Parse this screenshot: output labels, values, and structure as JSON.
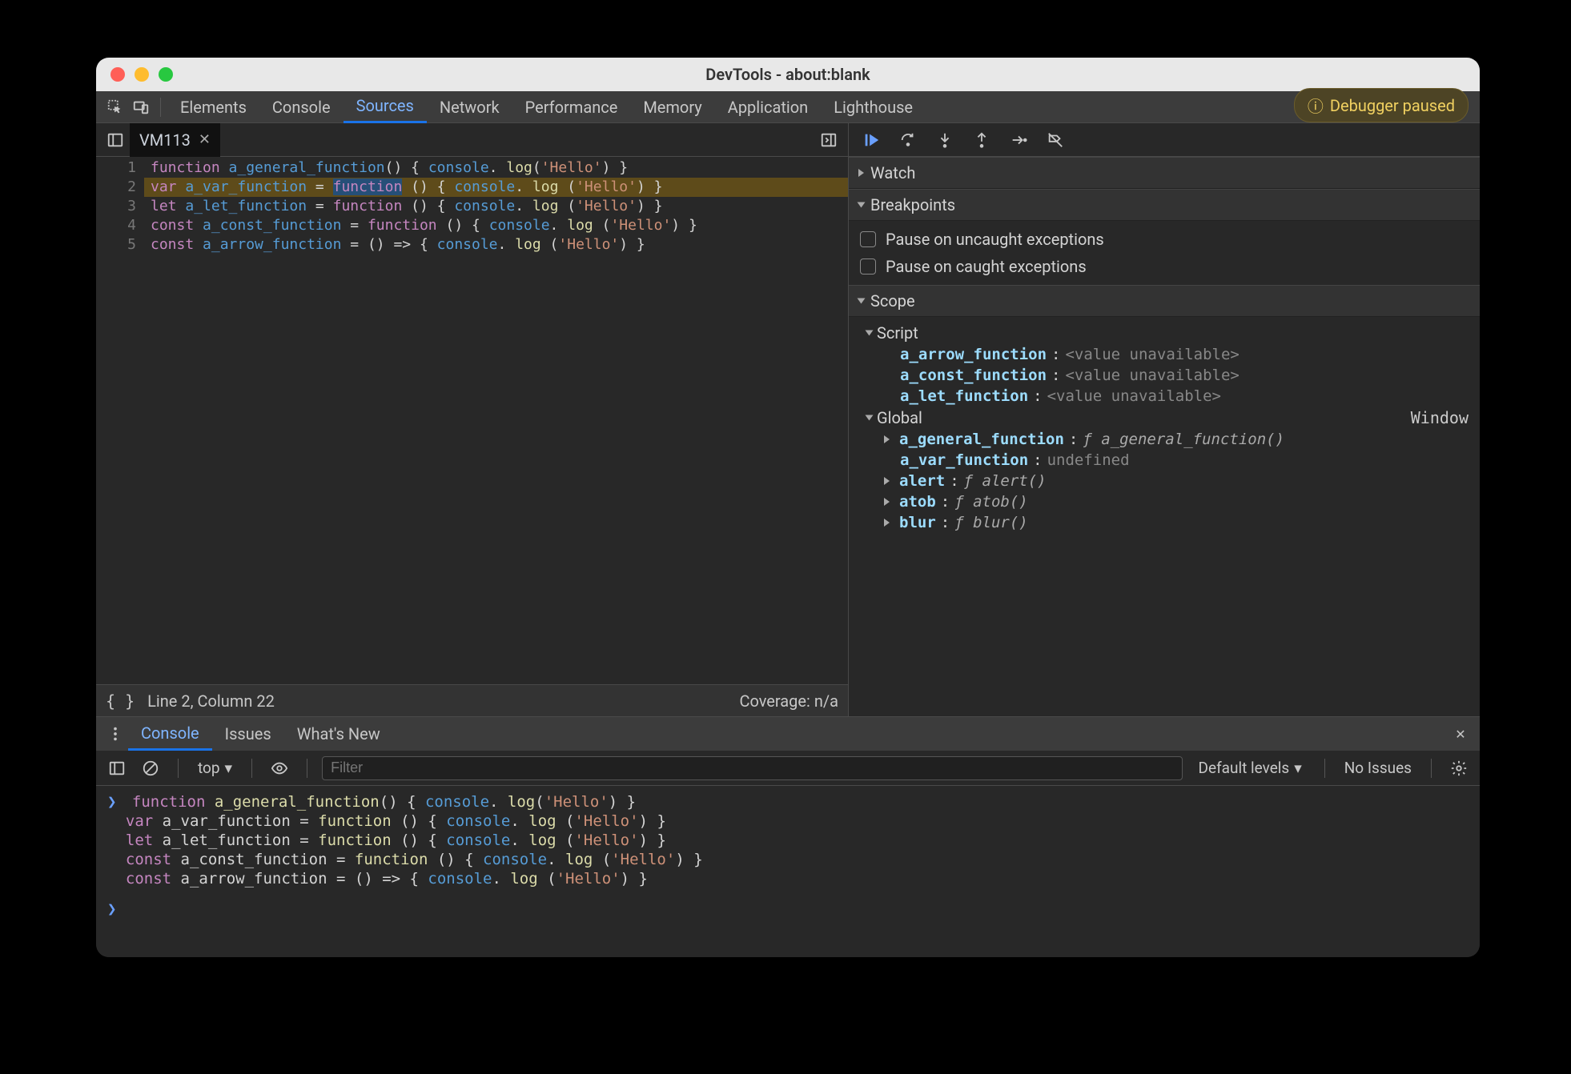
{
  "window": {
    "title": "DevTools - about:blank"
  },
  "main_tabs": [
    "Elements",
    "Console",
    "Sources",
    "Network",
    "Performance",
    "Memory",
    "Application",
    "Lighthouse"
  ],
  "main_active": "Sources",
  "file_tab": {
    "name": "VM113",
    "closeable": true
  },
  "editor": {
    "lines": [
      {
        "n": 1,
        "tokens": [
          [
            "function ",
            "k-purple"
          ],
          [
            "a_general_function",
            "k-blue"
          ],
          [
            "() { ",
            "k-plain"
          ],
          [
            "console",
            "k-blue"
          ],
          [
            ". ",
            "k-plain"
          ],
          [
            "log",
            "k-fn"
          ],
          [
            "(",
            "k-plain"
          ],
          [
            "'Hello'",
            "k-str"
          ],
          [
            ") }",
            "k-plain"
          ]
        ]
      },
      {
        "n": 2,
        "hl": true,
        "tokens": [
          [
            "var ",
            "k-purple"
          ],
          [
            "a_var_function ",
            "k-blue"
          ],
          [
            "= ",
            "k-plain"
          ],
          [
            "function",
            "k-purple",
            "sel"
          ],
          [
            " () { ",
            "k-plain"
          ],
          [
            "console",
            "k-blue"
          ],
          [
            ". ",
            "k-plain"
          ],
          [
            "log",
            "k-fn"
          ],
          [
            " (",
            "k-plain"
          ],
          [
            "'Hello'",
            "k-str"
          ],
          [
            ") }",
            "k-plain"
          ]
        ]
      },
      {
        "n": 3,
        "tokens": [
          [
            "let ",
            "k-purple"
          ],
          [
            "a_let_function ",
            "k-blue"
          ],
          [
            "= ",
            "k-plain"
          ],
          [
            "function",
            "k-purple"
          ],
          [
            " () { ",
            "k-plain"
          ],
          [
            "console",
            "k-blue"
          ],
          [
            ". ",
            "k-plain"
          ],
          [
            "log",
            "k-fn"
          ],
          [
            " (",
            "k-plain"
          ],
          [
            "'Hello'",
            "k-str"
          ],
          [
            ") }",
            "k-plain"
          ]
        ]
      },
      {
        "n": 4,
        "tokens": [
          [
            "const ",
            "k-purple"
          ],
          [
            "a_const_function ",
            "k-blue"
          ],
          [
            "= ",
            "k-plain"
          ],
          [
            "function",
            "k-purple"
          ],
          [
            " () { ",
            "k-plain"
          ],
          [
            "console",
            "k-blue"
          ],
          [
            ". ",
            "k-plain"
          ],
          [
            "log",
            "k-fn"
          ],
          [
            " (",
            "k-plain"
          ],
          [
            "'Hello'",
            "k-str"
          ],
          [
            ") }",
            "k-plain"
          ]
        ]
      },
      {
        "n": 5,
        "tokens": [
          [
            "const ",
            "k-purple"
          ],
          [
            "a_arrow_function ",
            "k-blue"
          ],
          [
            "= () => { ",
            "k-plain"
          ],
          [
            "console",
            "k-blue"
          ],
          [
            ". ",
            "k-plain"
          ],
          [
            "log",
            "k-fn"
          ],
          [
            " (",
            "k-plain"
          ],
          [
            "'Hello'",
            "k-str"
          ],
          [
            ") }",
            "k-plain"
          ]
        ]
      }
    ]
  },
  "status": {
    "cursor": "Line 2, Column 22",
    "coverage": "Coverage: n/a"
  },
  "debugger": {
    "paused_badge": "Debugger paused",
    "panes": {
      "watch": {
        "label": "Watch",
        "open": false
      },
      "breakpoints": {
        "label": "Breakpoints",
        "open": true,
        "uncaught": "Pause on uncaught exceptions",
        "caught": "Pause on caught exceptions"
      },
      "scope": {
        "label": "Scope",
        "open": true,
        "script_label": "Script",
        "script": [
          {
            "name": "a_arrow_function",
            "value": "<value unavailable>"
          },
          {
            "name": "a_const_function",
            "value": "<value unavailable>"
          },
          {
            "name": "a_let_function",
            "value": "<value unavailable>"
          }
        ],
        "global_label": "Global",
        "global_type": "Window",
        "global": [
          {
            "name": "a_general_function",
            "value": "ƒ a_general_function()",
            "italic": true,
            "expandable": true
          },
          {
            "name": "a_var_function",
            "value": "undefined"
          },
          {
            "name": "alert",
            "value": "ƒ alert()",
            "italic": true,
            "expandable": true
          },
          {
            "name": "atob",
            "value": "ƒ atob()",
            "italic": true,
            "expandable": true
          },
          {
            "name": "blur",
            "value": "ƒ blur()",
            "italic": true,
            "expandable": true
          }
        ]
      }
    }
  },
  "drawer": {
    "tabs": [
      "Console",
      "Issues",
      "What's New"
    ],
    "active": "Console",
    "toolbar": {
      "context": "top",
      "filter_placeholder": "Filter",
      "levels": "Default levels",
      "issues": "No Issues"
    },
    "console_lines": [
      [
        [
          "function ",
          "k-purple"
        ],
        [
          "a_general_function",
          "k-fn"
        ],
        [
          "() { ",
          "k-plain"
        ],
        [
          "console",
          "k-blue"
        ],
        [
          ". ",
          "k-plain"
        ],
        [
          "log",
          "k-fn"
        ],
        [
          "(",
          "k-plain"
        ],
        [
          "'Hello'",
          "k-str"
        ],
        [
          ") }",
          "k-plain"
        ]
      ],
      [
        [
          "var ",
          "k-purple"
        ],
        [
          "a_var_function ",
          "k-plain"
        ],
        [
          "= ",
          "k-plain"
        ],
        [
          "function",
          "k-fn"
        ],
        [
          " () { ",
          "k-plain"
        ],
        [
          "console",
          "k-blue"
        ],
        [
          ". ",
          "k-plain"
        ],
        [
          "log",
          "k-fn"
        ],
        [
          " (",
          "k-plain"
        ],
        [
          "'Hello'",
          "k-str"
        ],
        [
          ") }",
          "k-plain"
        ]
      ],
      [
        [
          "let ",
          "k-purple"
        ],
        [
          "a_let_function ",
          "k-plain"
        ],
        [
          "= ",
          "k-plain"
        ],
        [
          "function",
          "k-fn"
        ],
        [
          " () { ",
          "k-plain"
        ],
        [
          "console",
          "k-blue"
        ],
        [
          ". ",
          "k-plain"
        ],
        [
          "log",
          "k-fn"
        ],
        [
          " (",
          "k-plain"
        ],
        [
          "'Hello'",
          "k-str"
        ],
        [
          ") }",
          "k-plain"
        ]
      ],
      [
        [
          "const ",
          "k-purple"
        ],
        [
          "a_const_function ",
          "k-plain"
        ],
        [
          "= ",
          "k-plain"
        ],
        [
          "function",
          "k-fn"
        ],
        [
          " () { ",
          "k-plain"
        ],
        [
          "console",
          "k-blue"
        ],
        [
          ". ",
          "k-plain"
        ],
        [
          "log",
          "k-fn"
        ],
        [
          " (",
          "k-plain"
        ],
        [
          "'Hello'",
          "k-str"
        ],
        [
          ") }",
          "k-plain"
        ]
      ],
      [
        [
          "const ",
          "k-purple"
        ],
        [
          "a_arrow_function ",
          "k-plain"
        ],
        [
          "= () => { ",
          "k-plain"
        ],
        [
          "console",
          "k-blue"
        ],
        [
          ". ",
          "k-plain"
        ],
        [
          "log",
          "k-fn"
        ],
        [
          " (",
          "k-plain"
        ],
        [
          "'Hello'",
          "k-str"
        ],
        [
          ") }",
          "k-plain"
        ]
      ]
    ]
  }
}
